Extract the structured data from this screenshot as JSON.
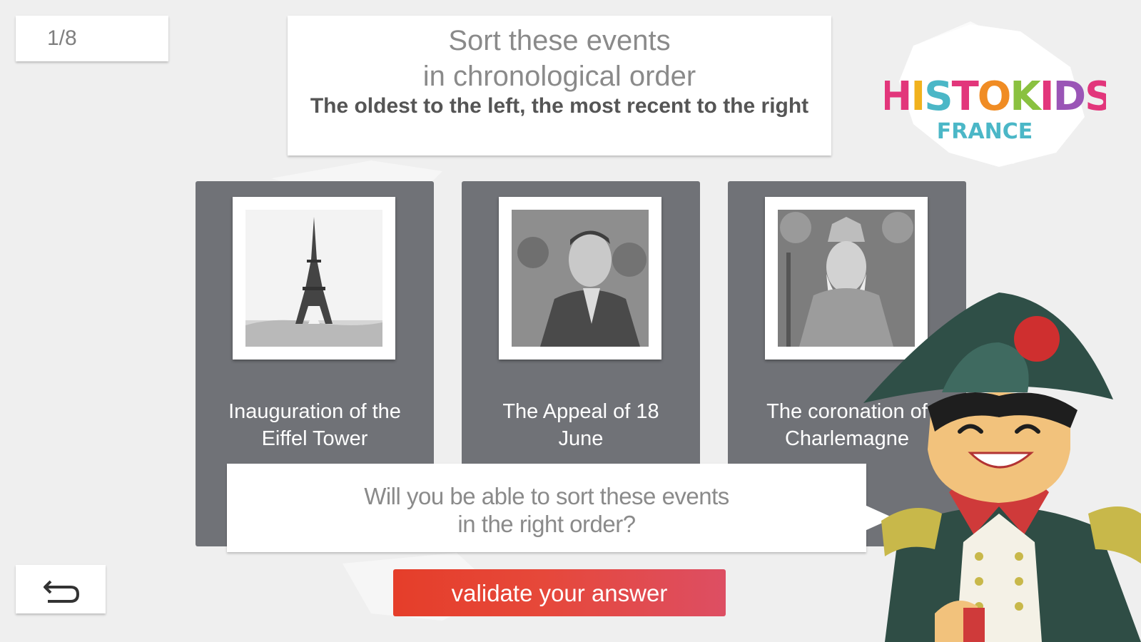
{
  "counter": {
    "text": "1/8"
  },
  "instructions": {
    "title_line1": "Sort these events",
    "title_line2": "in chronological order",
    "subtitle": "The oldest to the left, the most recent to the right"
  },
  "logo": {
    "word": "HISTOKIDS",
    "sub": "FRANCE"
  },
  "events": [
    {
      "label_line1": "Inauguration of the",
      "label_line2": "Eiffel Tower",
      "icon": "eiffel-tower-photo"
    },
    {
      "label_line1": "The Appeal of 18",
      "label_line2": "June",
      "icon": "de-gaulle-photo"
    },
    {
      "label_line1": "The coronation of",
      "label_line2": "Charlemagne",
      "icon": "charlemagne-portrait"
    }
  ],
  "speech": {
    "line1": "Will you be able to sort these events",
    "line2": "in the right order?"
  },
  "validate_button": {
    "label": "validate your answer"
  },
  "back_button": {
    "icon": "back-arrow-icon"
  },
  "colors": {
    "card": "#707277",
    "accent_red": "#e53e2a",
    "background": "#efefef",
    "hat": "#2f4f47"
  }
}
